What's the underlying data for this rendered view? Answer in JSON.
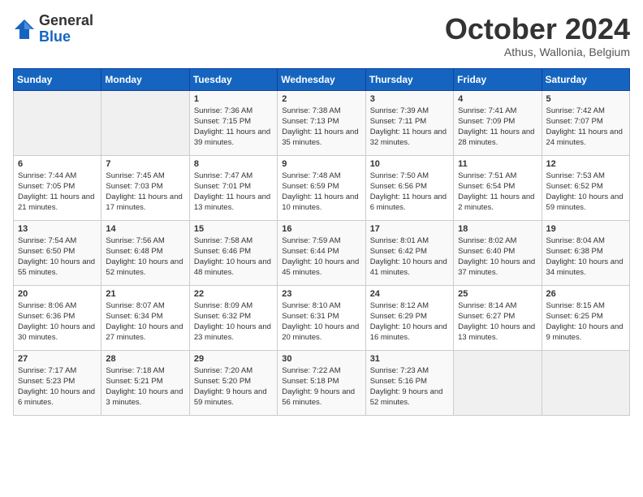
{
  "header": {
    "logo_general": "General",
    "logo_blue": "Blue",
    "month_title": "October 2024",
    "subtitle": "Athus, Wallonia, Belgium"
  },
  "days_of_week": [
    "Sunday",
    "Monday",
    "Tuesday",
    "Wednesday",
    "Thursday",
    "Friday",
    "Saturday"
  ],
  "weeks": [
    [
      {
        "day": "",
        "info": ""
      },
      {
        "day": "",
        "info": ""
      },
      {
        "day": "1",
        "info": "Sunrise: 7:36 AM\nSunset: 7:15 PM\nDaylight: 11 hours and 39 minutes."
      },
      {
        "day": "2",
        "info": "Sunrise: 7:38 AM\nSunset: 7:13 PM\nDaylight: 11 hours and 35 minutes."
      },
      {
        "day": "3",
        "info": "Sunrise: 7:39 AM\nSunset: 7:11 PM\nDaylight: 11 hours and 32 minutes."
      },
      {
        "day": "4",
        "info": "Sunrise: 7:41 AM\nSunset: 7:09 PM\nDaylight: 11 hours and 28 minutes."
      },
      {
        "day": "5",
        "info": "Sunrise: 7:42 AM\nSunset: 7:07 PM\nDaylight: 11 hours and 24 minutes."
      }
    ],
    [
      {
        "day": "6",
        "info": "Sunrise: 7:44 AM\nSunset: 7:05 PM\nDaylight: 11 hours and 21 minutes."
      },
      {
        "day": "7",
        "info": "Sunrise: 7:45 AM\nSunset: 7:03 PM\nDaylight: 11 hours and 17 minutes."
      },
      {
        "day": "8",
        "info": "Sunrise: 7:47 AM\nSunset: 7:01 PM\nDaylight: 11 hours and 13 minutes."
      },
      {
        "day": "9",
        "info": "Sunrise: 7:48 AM\nSunset: 6:59 PM\nDaylight: 11 hours and 10 minutes."
      },
      {
        "day": "10",
        "info": "Sunrise: 7:50 AM\nSunset: 6:56 PM\nDaylight: 11 hours and 6 minutes."
      },
      {
        "day": "11",
        "info": "Sunrise: 7:51 AM\nSunset: 6:54 PM\nDaylight: 11 hours and 2 minutes."
      },
      {
        "day": "12",
        "info": "Sunrise: 7:53 AM\nSunset: 6:52 PM\nDaylight: 10 hours and 59 minutes."
      }
    ],
    [
      {
        "day": "13",
        "info": "Sunrise: 7:54 AM\nSunset: 6:50 PM\nDaylight: 10 hours and 55 minutes."
      },
      {
        "day": "14",
        "info": "Sunrise: 7:56 AM\nSunset: 6:48 PM\nDaylight: 10 hours and 52 minutes."
      },
      {
        "day": "15",
        "info": "Sunrise: 7:58 AM\nSunset: 6:46 PM\nDaylight: 10 hours and 48 minutes."
      },
      {
        "day": "16",
        "info": "Sunrise: 7:59 AM\nSunset: 6:44 PM\nDaylight: 10 hours and 45 minutes."
      },
      {
        "day": "17",
        "info": "Sunrise: 8:01 AM\nSunset: 6:42 PM\nDaylight: 10 hours and 41 minutes."
      },
      {
        "day": "18",
        "info": "Sunrise: 8:02 AM\nSunset: 6:40 PM\nDaylight: 10 hours and 37 minutes."
      },
      {
        "day": "19",
        "info": "Sunrise: 8:04 AM\nSunset: 6:38 PM\nDaylight: 10 hours and 34 minutes."
      }
    ],
    [
      {
        "day": "20",
        "info": "Sunrise: 8:06 AM\nSunset: 6:36 PM\nDaylight: 10 hours and 30 minutes."
      },
      {
        "day": "21",
        "info": "Sunrise: 8:07 AM\nSunset: 6:34 PM\nDaylight: 10 hours and 27 minutes."
      },
      {
        "day": "22",
        "info": "Sunrise: 8:09 AM\nSunset: 6:32 PM\nDaylight: 10 hours and 23 minutes."
      },
      {
        "day": "23",
        "info": "Sunrise: 8:10 AM\nSunset: 6:31 PM\nDaylight: 10 hours and 20 minutes."
      },
      {
        "day": "24",
        "info": "Sunrise: 8:12 AM\nSunset: 6:29 PM\nDaylight: 10 hours and 16 minutes."
      },
      {
        "day": "25",
        "info": "Sunrise: 8:14 AM\nSunset: 6:27 PM\nDaylight: 10 hours and 13 minutes."
      },
      {
        "day": "26",
        "info": "Sunrise: 8:15 AM\nSunset: 6:25 PM\nDaylight: 10 hours and 9 minutes."
      }
    ],
    [
      {
        "day": "27",
        "info": "Sunrise: 7:17 AM\nSunset: 5:23 PM\nDaylight: 10 hours and 6 minutes."
      },
      {
        "day": "28",
        "info": "Sunrise: 7:18 AM\nSunset: 5:21 PM\nDaylight: 10 hours and 3 minutes."
      },
      {
        "day": "29",
        "info": "Sunrise: 7:20 AM\nSunset: 5:20 PM\nDaylight: 9 hours and 59 minutes."
      },
      {
        "day": "30",
        "info": "Sunrise: 7:22 AM\nSunset: 5:18 PM\nDaylight: 9 hours and 56 minutes."
      },
      {
        "day": "31",
        "info": "Sunrise: 7:23 AM\nSunset: 5:16 PM\nDaylight: 9 hours and 52 minutes."
      },
      {
        "day": "",
        "info": ""
      },
      {
        "day": "",
        "info": ""
      }
    ]
  ]
}
